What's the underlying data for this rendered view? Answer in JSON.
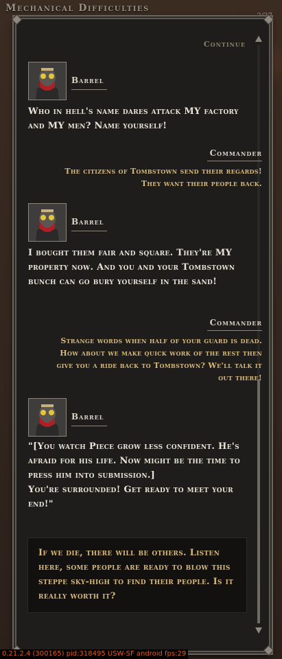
{
  "background": {
    "quest_title": "Mechanical Difficulties",
    "stat": "2/27"
  },
  "dialog": {
    "continue_label": "Continue",
    "entries": [
      {
        "speaker": "Barrel",
        "text": "Who in hell's name dares attack MY factory and MY men? Name yourself!"
      },
      {
        "speaker": "Commander",
        "text": "The citizens of Tombstown send their regards! They want their people back."
      },
      {
        "speaker": "Barrel",
        "text": "I bought them fair and square. They're MY property now. And you and your Tombstown bunch can go bury yourself in the sand!"
      },
      {
        "speaker": "Commander",
        "text": "Strange words when half of your guard is dead. How about we make quick work of the rest then give you a ride back to Tombstown? We'll talk it out there!"
      },
      {
        "speaker": "Barrel",
        "text": "\"[You watch Piece grow less confident. He's afraid for his life. Now might be the time to press him into submission.]\n You're surrounded! Get ready to meet your end!\""
      }
    ],
    "choice_text": "If we die, there will be others. Listen here, some people are ready to blow this steppe sky-high to find their people. Is it really worth it?"
  },
  "debug_text": "0.21.2.4 (300165) pid:318495 USW-SF android fps:29"
}
